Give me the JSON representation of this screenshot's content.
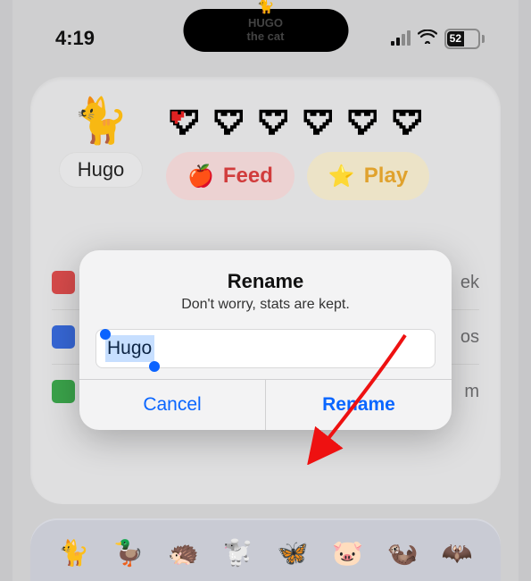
{
  "status_bar": {
    "time": "4:19",
    "battery_percent": "52"
  },
  "dynamic_island": {
    "line1": "HUGO",
    "line2": "the cat"
  },
  "card": {
    "pet_name": "Hugo",
    "hearts_total": 6,
    "hearts_filled_fraction": 0.3,
    "actions": {
      "feed": "Feed",
      "play": "Play"
    },
    "behind_rows": [
      {
        "suffix": "ek"
      },
      {
        "suffix": "os"
      },
      {
        "suffix": "m"
      }
    ]
  },
  "alert": {
    "title": "Rename",
    "subtitle": "Don't worry, stats are kept.",
    "input_value": "Hugo",
    "cancel": "Cancel",
    "confirm": "Rename"
  },
  "bottom_strip": {
    "sprites": [
      "🐈",
      "🦆",
      "🦔",
      "🐩",
      "🦋",
      "🐷",
      "🦦",
      "🦇"
    ]
  }
}
